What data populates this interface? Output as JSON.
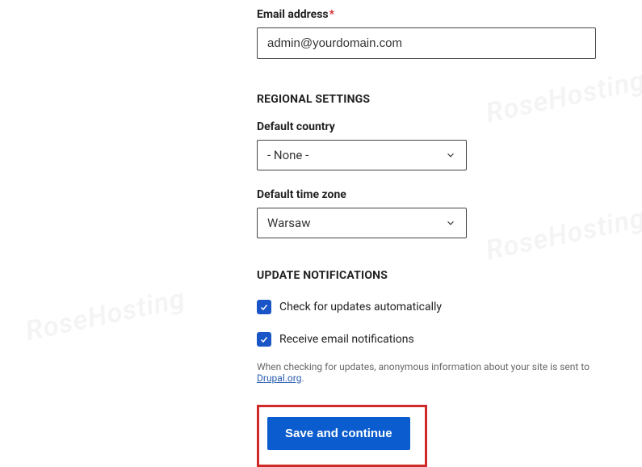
{
  "email": {
    "label": "Email address",
    "required_mark": "*",
    "value": "admin@yourdomain.com"
  },
  "regional": {
    "heading": "REGIONAL SETTINGS",
    "country": {
      "label": "Default country",
      "value": "- None -"
    },
    "timezone": {
      "label": "Default time zone",
      "value": "Warsaw"
    }
  },
  "updates": {
    "heading": "UPDATE NOTIFICATIONS",
    "check_auto": {
      "label": "Check for updates automatically",
      "checked": true
    },
    "email_notif": {
      "label": "Receive email notifications",
      "checked": true
    },
    "helper_pre": "When checking for updates, anonymous information about your site is sent to ",
    "helper_link": "Drupal.org",
    "helper_post": "."
  },
  "submit": {
    "label": "Save and continue"
  },
  "watermark": "RoseHosting"
}
